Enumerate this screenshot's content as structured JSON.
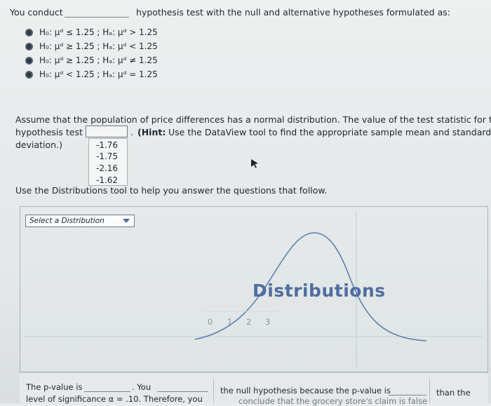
{
  "question": {
    "prefix": "You conduct",
    "suffix": "hypothesis test with the null and alternative hypotheses formulated as:"
  },
  "options": [
    {
      "label": "H₀: μᵈ ≤ 1.25 ; Hₐ: μᵈ > 1.25"
    },
    {
      "label": "H₀: μᵈ ≥ 1.25 ; Hₐ: μᵈ < 1.25"
    },
    {
      "label": "H₀: μᵈ ≥ 1.25 ; Hₐ: μᵈ ≠ 1.25"
    },
    {
      "label": "H₀: μᵈ < 1.25 ; Hₐ: μᵈ = 1.25"
    }
  ],
  "test_statistic": {
    "line1": "Assume that the population of price differences has a normal distribution. The value of the test statistic for the",
    "line2_prefix": "hypothesis test is",
    "line2_hint_bold": "(Hint:",
    "line2_hint_rest": "Use the DataView tool to find the appropriate sample mean and standard",
    "line3": "deviation.)",
    "dot": ".",
    "choices": [
      "-1.76",
      "-1.75",
      "-2.16",
      "-1.62"
    ]
  },
  "distributions_note": "Use the Distributions tool to help you answer the questions that follow.",
  "tool": {
    "select_label": "Select a Distribution",
    "title": "Distributions",
    "axis_ticks": [
      "0",
      "1",
      "2",
      "3"
    ]
  },
  "bottom": {
    "col1_line1_a": "The p-value is",
    "col1_line1_b": ". You",
    "col1_line2": "level of significance α = .10. Therefore, you",
    "col2_line1": "the null hypothesis because the p-value is",
    "col2_line2": "conclude that the grocery store's claim is false",
    "col3_line1": "than the"
  },
  "colors": {
    "curve": "#5b7fb0",
    "title": "#4f6e9e",
    "radio": "#2e3a44"
  }
}
